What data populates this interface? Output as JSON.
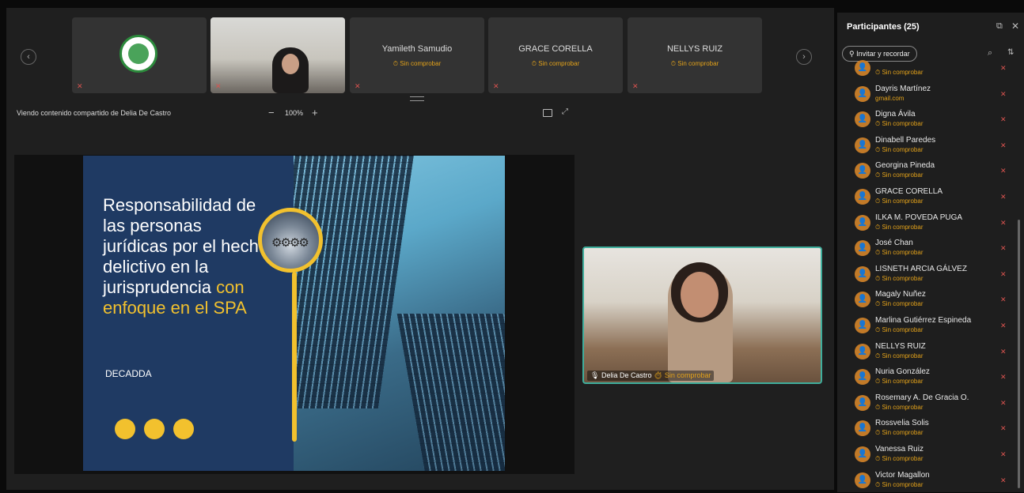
{
  "strip": {
    "prev": "‹",
    "next": "›",
    "tiles": [
      {
        "name": "",
        "status": ""
      },
      {
        "name": "",
        "status": ""
      },
      {
        "name": "Yamileth Samudio",
        "status": "⏱ Sin comprobar"
      },
      {
        "name": "GRACE CORELLA",
        "status": "⏱ Sin comprobar"
      },
      {
        "name": "NELLYS RUIZ",
        "status": "⏱ Sin comprobar"
      }
    ]
  },
  "toolbar": {
    "viewing": "Viendo contenido compartido de Delia De Castro",
    "zoom_minus": "−",
    "zoom": "100%",
    "zoom_plus": "+"
  },
  "slide": {
    "title_white": "Responsabilidad de las personas jurídicas por el hecho delictivo en la jurisprudencia",
    "title_yellow": "con enfoque en el SPA",
    "org": "DECADDA",
    "accent": "#f2c12e",
    "bg": "#1f3a63"
  },
  "pip": {
    "name": "Delia De Castro",
    "status": "⏱ Sin comprobar"
  },
  "panel": {
    "title": "Participantes (25)",
    "invite": "⚲ Invitar y recordar",
    "participants": [
      {
        "name": "",
        "status": "⏱ Sin comprobar"
      },
      {
        "name": "Dayris Martínez",
        "status": "gmail.com"
      },
      {
        "name": "Digna Ávila",
        "status": "⏱ Sin comprobar"
      },
      {
        "name": "Dinabell Paredes",
        "status": "⏱ Sin comprobar"
      },
      {
        "name": "Georgina Pineda",
        "status": "⏱ Sin comprobar"
      },
      {
        "name": "GRACE CORELLA",
        "status": "⏱ Sin comprobar"
      },
      {
        "name": "ILKA M. POVEDA PUGA",
        "status": "⏱ Sin comprobar"
      },
      {
        "name": "José Chan",
        "status": "⏱ Sin comprobar"
      },
      {
        "name": "LISNETH ARCIA GÁLVEZ",
        "status": "⏱ Sin comprobar"
      },
      {
        "name": "Magaly Nuñez",
        "status": "⏱ Sin comprobar"
      },
      {
        "name": "Marlina Gutiérrez Espineda",
        "status": "⏱ Sin comprobar"
      },
      {
        "name": "NELLYS RUIZ",
        "status": "⏱ Sin comprobar"
      },
      {
        "name": "Nuria González",
        "status": "⏱ Sin comprobar"
      },
      {
        "name": "Rosemary A. De Gracia O.",
        "status": "⏱ Sin comprobar"
      },
      {
        "name": "Rossvelia Solis",
        "status": "⏱ Sin comprobar"
      },
      {
        "name": "Vanessa Ruiz",
        "status": "⏱ Sin comprobar"
      },
      {
        "name": "Victor Magallon",
        "status": "⏱ Sin comprobar"
      }
    ]
  }
}
